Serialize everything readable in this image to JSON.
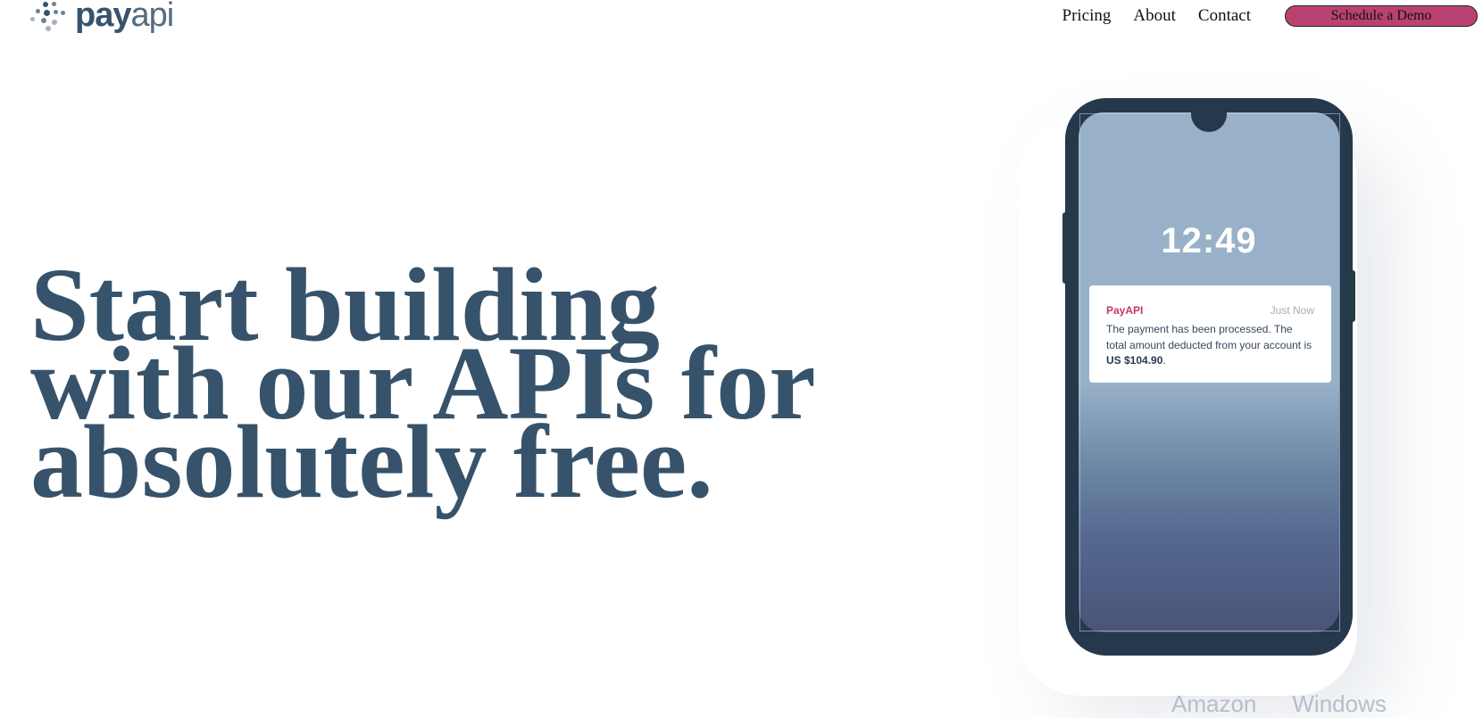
{
  "brand": {
    "name_bold": "pay",
    "name_light": "api",
    "dot_colors": [
      "#36536b",
      "#6f8294",
      "#a6b1be"
    ]
  },
  "nav": {
    "links": [
      "Pricing",
      "About",
      "Contact"
    ],
    "cta_label": "Schedule a Demo",
    "cta_color": "#ba4270"
  },
  "hero": {
    "title_lines": [
      "Start building",
      "with our APIs for",
      "absolutely free."
    ],
    "title_color": "#36536b"
  },
  "phone": {
    "clock": "12:49",
    "notification": {
      "app": "PayAPI",
      "time": "Just Now",
      "message": "The payment has been processed. The total amount deducted from your account is",
      "amount": "US $104.90",
      "suffix": "."
    }
  },
  "clients_strip": [
    "Amazon",
    "Windows"
  ]
}
